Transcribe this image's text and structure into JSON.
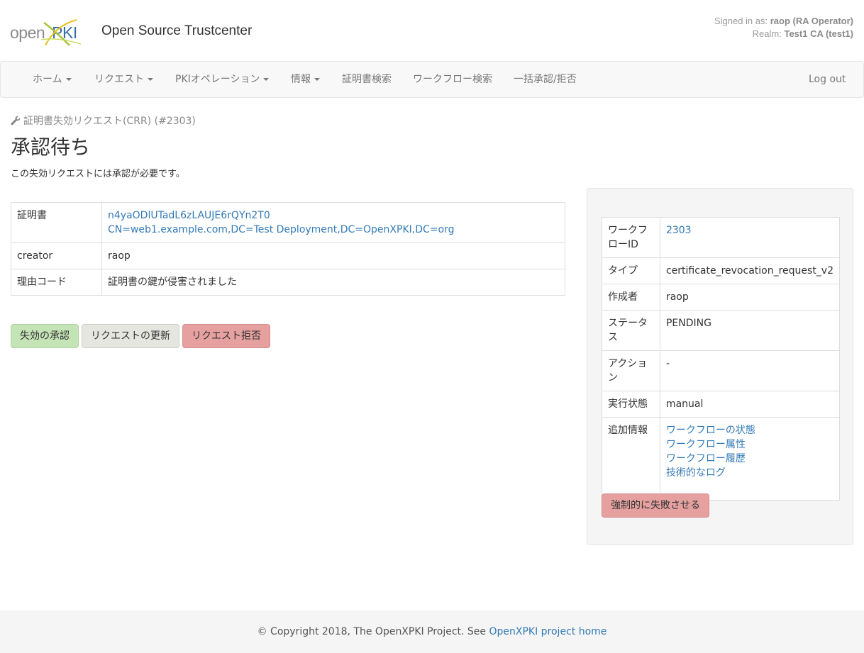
{
  "header": {
    "logo_open": "open",
    "logo_pki": "PKI",
    "app_title": "Open Source Trustcenter",
    "signed_in_label": "Signed in as:",
    "signed_in_user": "raop (RA Operator)",
    "realm_label": "Realm:",
    "realm_value": "Test1 CA (test1)"
  },
  "nav": {
    "items": [
      {
        "label": "ホーム"
      },
      {
        "label": "リクエスト"
      },
      {
        "label": "PKIオペレーション"
      },
      {
        "label": "情報"
      },
      {
        "label": "証明書検索"
      },
      {
        "label": "ワークフロー検索"
      },
      {
        "label": "一括承認/拒否"
      }
    ],
    "logout": "Log out"
  },
  "page": {
    "subtitle": "証明書失効リクエスト(CRR) (#2303)",
    "title": "承認待ち",
    "description": "この失効リクエストには承認が必要です。"
  },
  "details": {
    "rows": [
      {
        "label": "証明書",
        "value1": "n4yaODlUTadL6zLAUJE6rQYn2T0",
        "value2": "CN=web1.example.com,DC=Test Deployment,DC=OpenXPKI,DC=org"
      },
      {
        "label": "creator",
        "value": "raop"
      },
      {
        "label": "理由コード",
        "value": "証明書の鍵が侵害されました"
      }
    ]
  },
  "actions": {
    "approve": "失効の承認",
    "update": "リクエストの更新",
    "reject": "リクエスト拒否"
  },
  "workflow": {
    "id_label": "ワークフローID",
    "id_value": "2303",
    "type_label": "タイプ",
    "type_value": "certificate_revocation_request_v2",
    "creator_label": "作成者",
    "creator_value": "raop",
    "status_label": "ステータス",
    "status_value": "PENDING",
    "action_label": "アクション",
    "action_value": "-",
    "exec_label": "実行状態",
    "exec_value": "manual",
    "extra_label": "追加情報",
    "extra_links": [
      "ワークフローの状態",
      "ワークフロー属性",
      "ワークフロー履歴",
      "技術的なログ"
    ],
    "force_fail": "強制的に失敗させる"
  },
  "footer": {
    "text": "© Copyright 2018, The OpenXPKI Project. See ",
    "link": "OpenXPKI project home"
  },
  "colors": {
    "link": "#337ab7",
    "approve_bg": "#c5e4b6",
    "update_bg": "#e6e6e0",
    "reject_bg": "#e6a0a0"
  }
}
